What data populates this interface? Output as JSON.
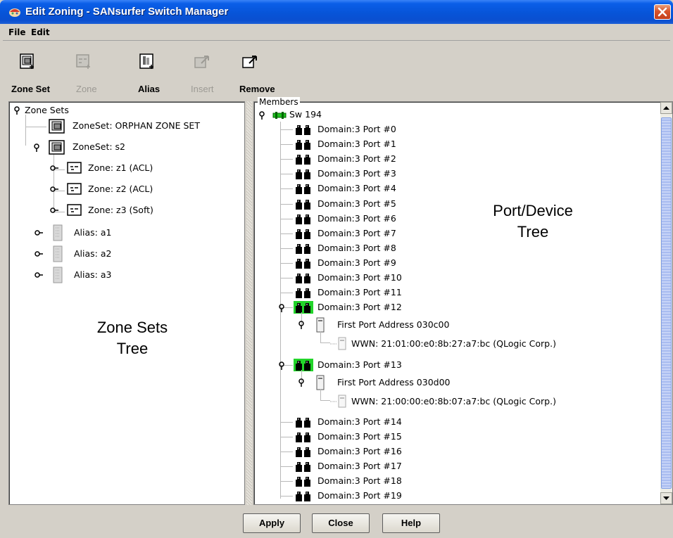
{
  "window": {
    "title": "Edit Zoning - SANsurfer Switch Manager"
  },
  "menu": [
    {
      "label": "File"
    },
    {
      "label": "Edit"
    }
  ],
  "toolbar": [
    {
      "label": "Zone Set",
      "enabled": true,
      "icon": "zone-set-icon"
    },
    {
      "label": "Zone",
      "enabled": false,
      "icon": "zone-icon"
    },
    {
      "label": "Alias",
      "enabled": true,
      "icon": "alias-icon"
    },
    {
      "label": "Insert",
      "enabled": false,
      "icon": "insert-icon"
    },
    {
      "label": "Remove",
      "enabled": true,
      "icon": "remove-icon"
    }
  ],
  "zone_tree": {
    "root": "Zone Sets",
    "items": [
      {
        "label": "ZoneSet: ORPHAN ZONE SET",
        "type": "zoneset"
      },
      {
        "label": "ZoneSet: s2",
        "type": "zoneset"
      },
      {
        "label": "Zone: z1 (ACL)",
        "type": "zone"
      },
      {
        "label": "Zone: z2 (ACL)",
        "type": "zone"
      },
      {
        "label": "Zone: z3 (Soft)",
        "type": "zone"
      },
      {
        "label": "Alias: a1",
        "type": "alias"
      },
      {
        "label": "Alias: a2",
        "type": "alias"
      },
      {
        "label": "Alias: a3",
        "type": "alias"
      }
    ]
  },
  "members_label": "Members",
  "switch_label": "Sw 194",
  "ports": [
    "Domain:3 Port #0",
    "Domain:3 Port #1",
    "Domain:3 Port #2",
    "Domain:3 Port #3",
    "Domain:3 Port #4",
    "Domain:3 Port #5",
    "Domain:3 Port #6",
    "Domain:3 Port #7",
    "Domain:3 Port #8",
    "Domain:3 Port #9",
    "Domain:3 Port #10",
    "Domain:3 Port #11",
    "Domain:3 Port #12",
    "Domain:3 Port #13",
    "Domain:3 Port #14",
    "Domain:3 Port #15",
    "Domain:3 Port #16",
    "Domain:3 Port #17",
    "Domain:3 Port #18",
    "Domain:3 Port #19"
  ],
  "port12": {
    "address": "First Port Address 030c00",
    "wwn": "WWN: 21:01:00:e0:8b:27:a7:bc (QLogic Corp.)"
  },
  "port13": {
    "address": "First Port Address 030d00",
    "wwn": "WWN: 21:00:00:e0:8b:07:a7:bc (QLogic Corp.)"
  },
  "annotations": {
    "zone_tree": "Zone Sets\nTree",
    "port_tree": "Port/Device\nTree"
  },
  "buttons": {
    "apply": "Apply",
    "close": "Close",
    "help": "Help"
  },
  "colors": {
    "titlebar": "#0754d8",
    "active_port": "#22d42a",
    "switch_icon": "#20c020"
  }
}
